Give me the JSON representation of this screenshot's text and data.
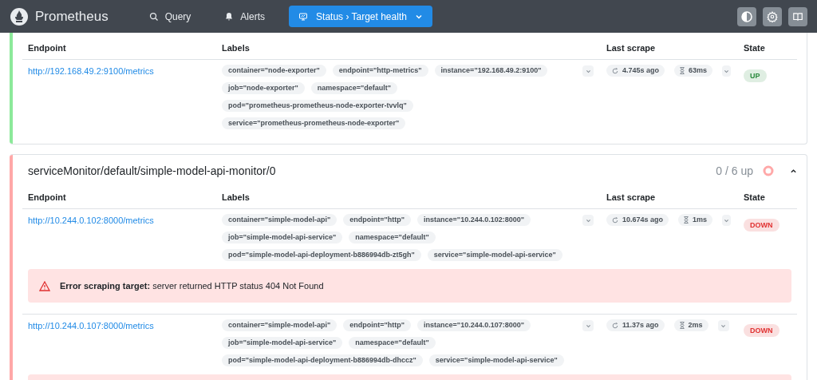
{
  "header": {
    "brand": "Prometheus",
    "nav": [
      {
        "kind": "search",
        "label": "Query",
        "selected": false
      },
      {
        "kind": "bell",
        "label": "Alerts",
        "selected": false
      },
      {
        "kind": "status",
        "label": "Status › Target health",
        "selected": true
      }
    ]
  },
  "pools": [
    {
      "color": "#8ce99a",
      "columns": [
        "Endpoint",
        "Labels",
        "Last scrape",
        "State"
      ],
      "targets": [
        {
          "endpoint": "http://192.168.49.2:9100/metrics",
          "labels": [
            "container=\"node-exporter\"",
            "endpoint=\"http-metrics\"",
            "instance=\"192.168.49.2:9100\"",
            "job=\"node-exporter\"",
            "namespace=\"default\"",
            "pod=\"prometheus-prometheus-node-exporter-tvvlq\"",
            "service=\"prometheus-prometheus-node-exporter\""
          ],
          "last_scrape": "4.745s ago",
          "duration": "63ms",
          "state": "UP",
          "color": "#2b8a3e"
        }
      ]
    },
    {
      "title": "serviceMonitor/default/simple-model-api-monitor/0",
      "count": "0 / 6 up",
      "color": "#ffa8a8",
      "expanded": true,
      "columns": [
        "Endpoint",
        "Labels",
        "Last scrape",
        "State"
      ],
      "targets": [
        {
          "endpoint": "http://10.244.0.102:8000/metrics",
          "labels": [
            "container=\"simple-model-api\"",
            "endpoint=\"http\"",
            "instance=\"10.244.0.102:8000\"",
            "job=\"simple-model-api-service\"",
            "namespace=\"default\"",
            "pod=\"simple-model-api-deployment-b886994db-zt5gh\"",
            "service=\"simple-model-api-service\""
          ],
          "last_scrape": "10.674s ago",
          "duration": "1ms",
          "state": "DOWN",
          "color": "#e03131",
          "error_banner": true,
          "error": {
            "title": "Error scraping target:",
            "message": "server returned HTTP status 404 Not Found"
          }
        },
        {
          "endpoint": "http://10.244.0.107:8000/metrics",
          "labels": [
            "container=\"simple-model-api\"",
            "endpoint=\"http\"",
            "instance=\"10.244.0.107:8000\"",
            "job=\"simple-model-api-service\"",
            "namespace=\"default\"",
            "pod=\"simple-model-api-deployment-b886994db-dhccz\"",
            "service=\"simple-model-api-service\""
          ],
          "last_scrape": "11.37s ago",
          "duration": "2ms",
          "state": "DOWN",
          "color": "#e03131",
          "error_banner": true
        }
      ]
    }
  ]
}
